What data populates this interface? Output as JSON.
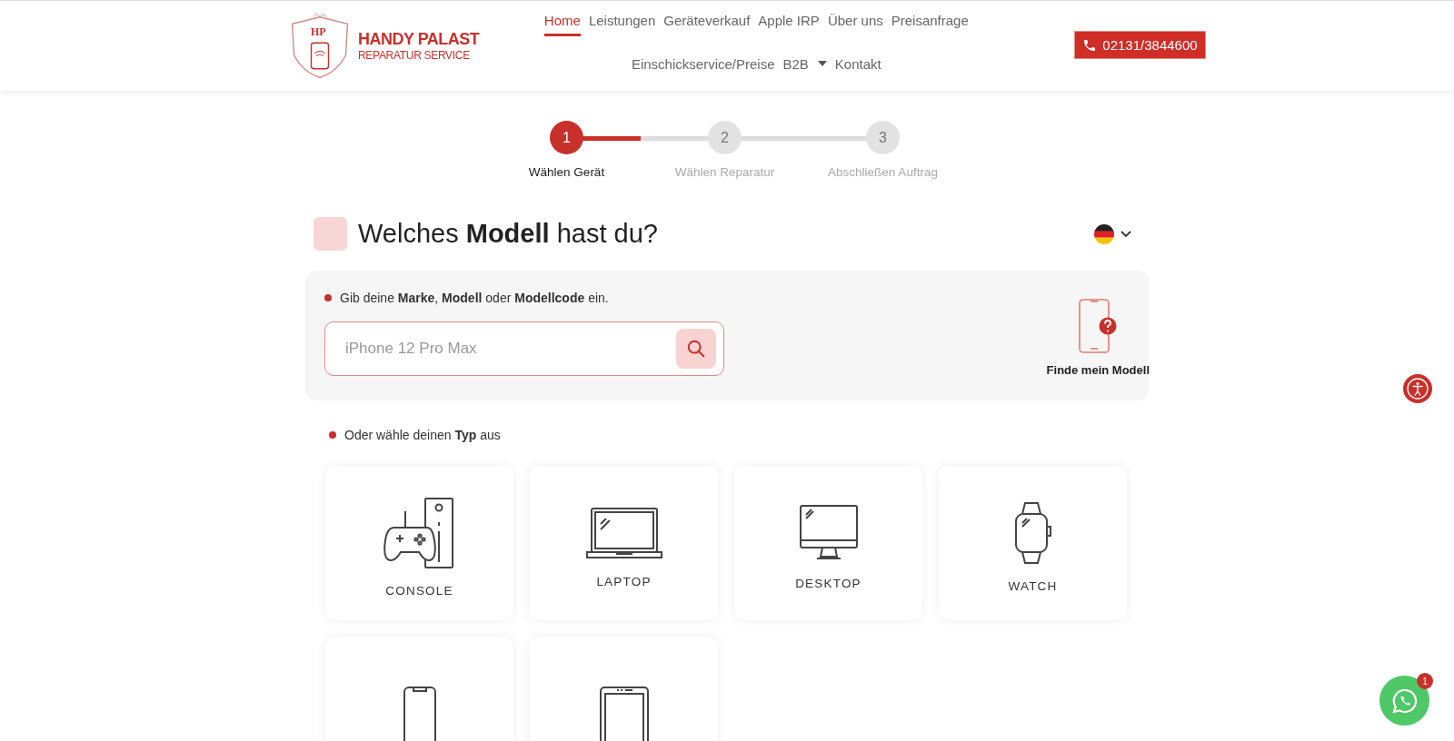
{
  "header": {
    "logo": {
      "badge": "HP",
      "title": "HANDY PALAST",
      "subtitle": "REPARATUR SERVICE"
    },
    "nav": [
      {
        "label": "Home",
        "selected": true,
        "dropdown": false
      },
      {
        "label": "Leistungen",
        "selected": false,
        "dropdown": false
      },
      {
        "label": "Geräteverkauf",
        "selected": false,
        "dropdown": false
      },
      {
        "label": "Apple IRP",
        "selected": false,
        "dropdown": false
      },
      {
        "label": "Über uns",
        "selected": false,
        "dropdown": false
      },
      {
        "label": "Preisanfrage",
        "selected": false,
        "dropdown": false
      },
      {
        "label": "Einschickservice/Preise",
        "selected": false,
        "dropdown": false
      },
      {
        "label": "B2B",
        "selected": false,
        "dropdown": true
      },
      {
        "label": "Kontakt",
        "selected": false,
        "dropdown": false
      }
    ],
    "phone": "02131/3844600"
  },
  "stepper": {
    "level": 0.25,
    "steps": [
      {
        "number": "1",
        "label": "Wählen Gerät",
        "selected": true
      },
      {
        "number": "2",
        "label": "Wählen Reparatur",
        "selected": false
      },
      {
        "number": "3",
        "label": "Abschließen Auftrag",
        "selected": false
      }
    ]
  },
  "heading": "Welches **Modell** hast du?",
  "search": {
    "hint": "Gib deine **Marke**, **Modell** oder **Modellcode** ein.",
    "placeholder": "iPhone 12 Pro Max",
    "find_model": "Finde mein Modell"
  },
  "types": {
    "hint": "Oder wähle deinen **Typ** aus",
    "items": [
      {
        "kind": "console",
        "label": "CONSOLE"
      },
      {
        "kind": "laptop",
        "label": "LAPTOP"
      },
      {
        "kind": "desktop",
        "label": "DESKTOP"
      },
      {
        "kind": "watch",
        "label": "WATCH"
      },
      {
        "kind": "phone"
      },
      {
        "kind": "tablet"
      }
    ]
  },
  "whatsapp": {
    "badge": "1"
  }
}
